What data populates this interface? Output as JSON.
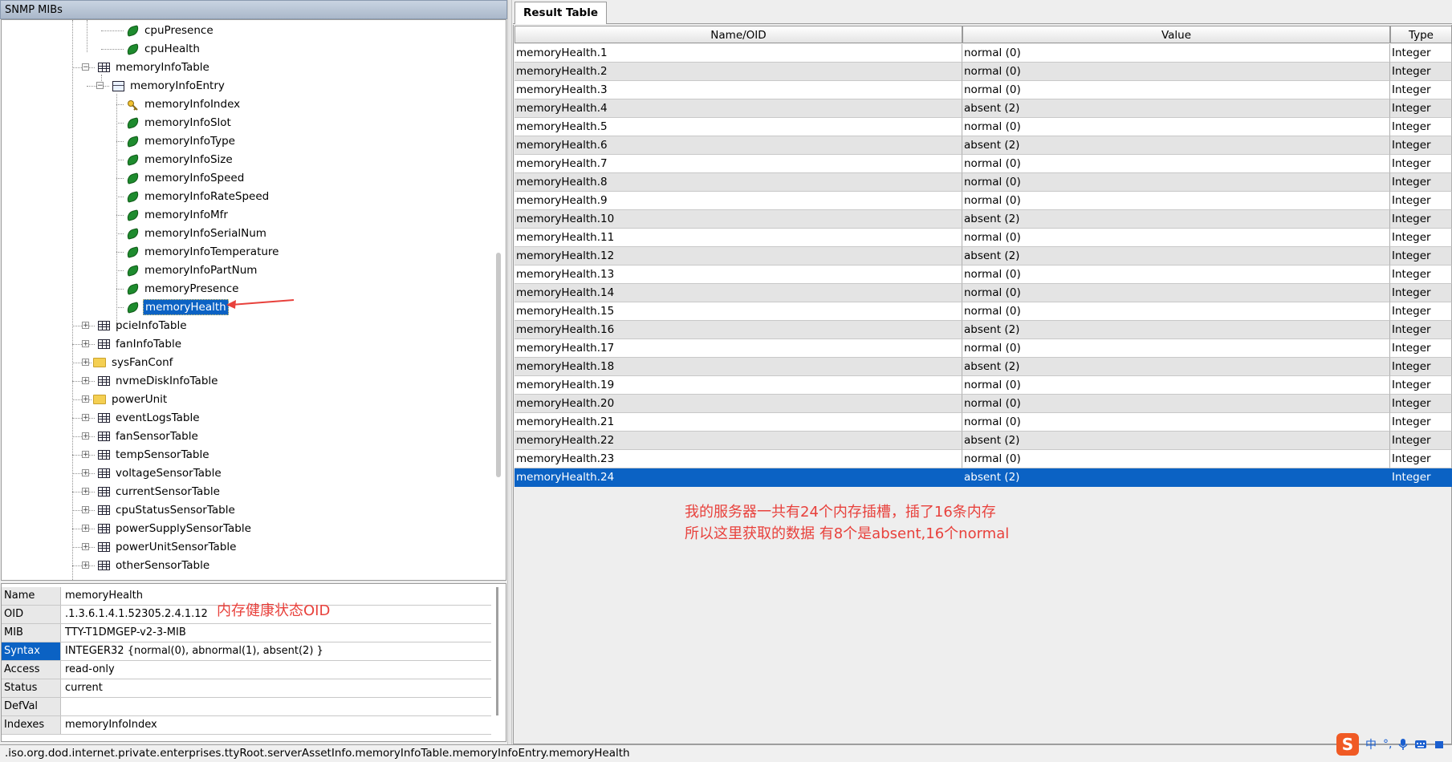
{
  "panel_title": "SNMP MIBs",
  "tree_items": [
    {
      "label": "cpuPresence",
      "icon": "leaf-icon"
    },
    {
      "label": "cpuHealth",
      "icon": "leaf-icon"
    },
    {
      "label": "memoryInfoTable",
      "icon": "table-icon",
      "expanded": true
    },
    {
      "label": "memoryInfoEntry",
      "icon": "entry-icon",
      "expanded": true
    },
    {
      "label": "memoryInfoIndex",
      "icon": "key-icon"
    },
    {
      "label": "memoryInfoSlot",
      "icon": "leaf-icon"
    },
    {
      "label": "memoryInfoType",
      "icon": "leaf-icon"
    },
    {
      "label": "memoryInfoSize",
      "icon": "leaf-icon"
    },
    {
      "label": "memoryInfoSpeed",
      "icon": "leaf-icon"
    },
    {
      "label": "memoryInfoRateSpeed",
      "icon": "leaf-icon"
    },
    {
      "label": "memoryInfoMfr",
      "icon": "leaf-icon"
    },
    {
      "label": "memoryInfoSerialNum",
      "icon": "leaf-icon"
    },
    {
      "label": "memoryInfoTemperature",
      "icon": "leaf-icon"
    },
    {
      "label": "memoryInfoPartNum",
      "icon": "leaf-icon"
    },
    {
      "label": "memoryPresence",
      "icon": "leaf-icon"
    },
    {
      "label": "memoryHealth",
      "icon": "leaf-icon",
      "selected": true
    },
    {
      "label": "pcieInfoTable",
      "icon": "table-icon"
    },
    {
      "label": "fanInfoTable",
      "icon": "table-icon"
    },
    {
      "label": "sysFanConf",
      "icon": "folder-icon"
    },
    {
      "label": "nvmeDiskInfoTable",
      "icon": "table-icon"
    },
    {
      "label": "powerUnit",
      "icon": "folder-icon"
    },
    {
      "label": "eventLogsTable",
      "icon": "table-icon"
    },
    {
      "label": "fanSensorTable",
      "icon": "table-icon"
    },
    {
      "label": "tempSensorTable",
      "icon": "table-icon"
    },
    {
      "label": "voltageSensorTable",
      "icon": "table-icon"
    },
    {
      "label": "currentSensorTable",
      "icon": "table-icon"
    },
    {
      "label": "cpuStatusSensorTable",
      "icon": "table-icon"
    },
    {
      "label": "powerSupplySensorTable",
      "icon": "table-icon"
    },
    {
      "label": "powerUnitSensorTable",
      "icon": "table-icon"
    },
    {
      "label": "otherSensorTable",
      "icon": "table-icon"
    }
  ],
  "properties": [
    {
      "name": "Name",
      "value": "memoryHealth"
    },
    {
      "name": "OID",
      "value": ".1.3.6.1.4.1.52305.2.4.1.12"
    },
    {
      "name": "MIB",
      "value": "TTY-T1DMGEP-v2-3-MIB"
    },
    {
      "name": "Syntax",
      "value": "INTEGER32 {normal(0), abnormal(1), absent(2) }",
      "selected": true
    },
    {
      "name": "Access",
      "value": "read-only"
    },
    {
      "name": "Status",
      "value": "current"
    },
    {
      "name": "DefVal",
      "value": ""
    },
    {
      "name": "Indexes",
      "value": "memoryInfoIndex"
    }
  ],
  "oid_annotation": "内存健康状态OID",
  "result_tab": "Result Table",
  "result_columns": [
    "Name/OID",
    "Value",
    "Type"
  ],
  "result_rows": [
    {
      "name": "memoryHealth.1",
      "value": "normal (0)",
      "type": "Integer"
    },
    {
      "name": "memoryHealth.2",
      "value": "normal (0)",
      "type": "Integer"
    },
    {
      "name": "memoryHealth.3",
      "value": "normal (0)",
      "type": "Integer"
    },
    {
      "name": "memoryHealth.4",
      "value": "absent (2)",
      "type": "Integer"
    },
    {
      "name": "memoryHealth.5",
      "value": "normal (0)",
      "type": "Integer"
    },
    {
      "name": "memoryHealth.6",
      "value": "absent (2)",
      "type": "Integer"
    },
    {
      "name": "memoryHealth.7",
      "value": "normal (0)",
      "type": "Integer"
    },
    {
      "name": "memoryHealth.8",
      "value": "normal (0)",
      "type": "Integer"
    },
    {
      "name": "memoryHealth.9",
      "value": "normal (0)",
      "type": "Integer"
    },
    {
      "name": "memoryHealth.10",
      "value": "absent (2)",
      "type": "Integer"
    },
    {
      "name": "memoryHealth.11",
      "value": "normal (0)",
      "type": "Integer"
    },
    {
      "name": "memoryHealth.12",
      "value": "absent (2)",
      "type": "Integer"
    },
    {
      "name": "memoryHealth.13",
      "value": "normal (0)",
      "type": "Integer"
    },
    {
      "name": "memoryHealth.14",
      "value": "normal (0)",
      "type": "Integer"
    },
    {
      "name": "memoryHealth.15",
      "value": "normal (0)",
      "type": "Integer"
    },
    {
      "name": "memoryHealth.16",
      "value": "absent (2)",
      "type": "Integer"
    },
    {
      "name": "memoryHealth.17",
      "value": "normal (0)",
      "type": "Integer"
    },
    {
      "name": "memoryHealth.18",
      "value": "absent (2)",
      "type": "Integer"
    },
    {
      "name": "memoryHealth.19",
      "value": "normal (0)",
      "type": "Integer"
    },
    {
      "name": "memoryHealth.20",
      "value": "normal (0)",
      "type": "Integer"
    },
    {
      "name": "memoryHealth.21",
      "value": "normal (0)",
      "type": "Integer"
    },
    {
      "name": "memoryHealth.22",
      "value": "absent (2)",
      "type": "Integer"
    },
    {
      "name": "memoryHealth.23",
      "value": "normal (0)",
      "type": "Integer"
    },
    {
      "name": "memoryHealth.24",
      "value": "absent (2)",
      "type": "Integer",
      "selected": true
    }
  ],
  "result_annotation": {
    "line1": "我的服务器一共有24个内存插槽，插了16条内存",
    "line2": "所以这里获取的数据 有8个是absent,16个normal"
  },
  "status_path": ".iso.org.dod.internet.private.enterprises.ttyRoot.serverAssetInfo.memoryInfoTable.memoryInfoEntry.memoryHealth",
  "ime": {
    "logo": "S",
    "lang": "中",
    "punct": "°,"
  },
  "colors": {
    "selection": "#0b62c4",
    "annotation": "#e8413c",
    "leaf": "#1e8b2e",
    "folder": "#f4cf52"
  }
}
